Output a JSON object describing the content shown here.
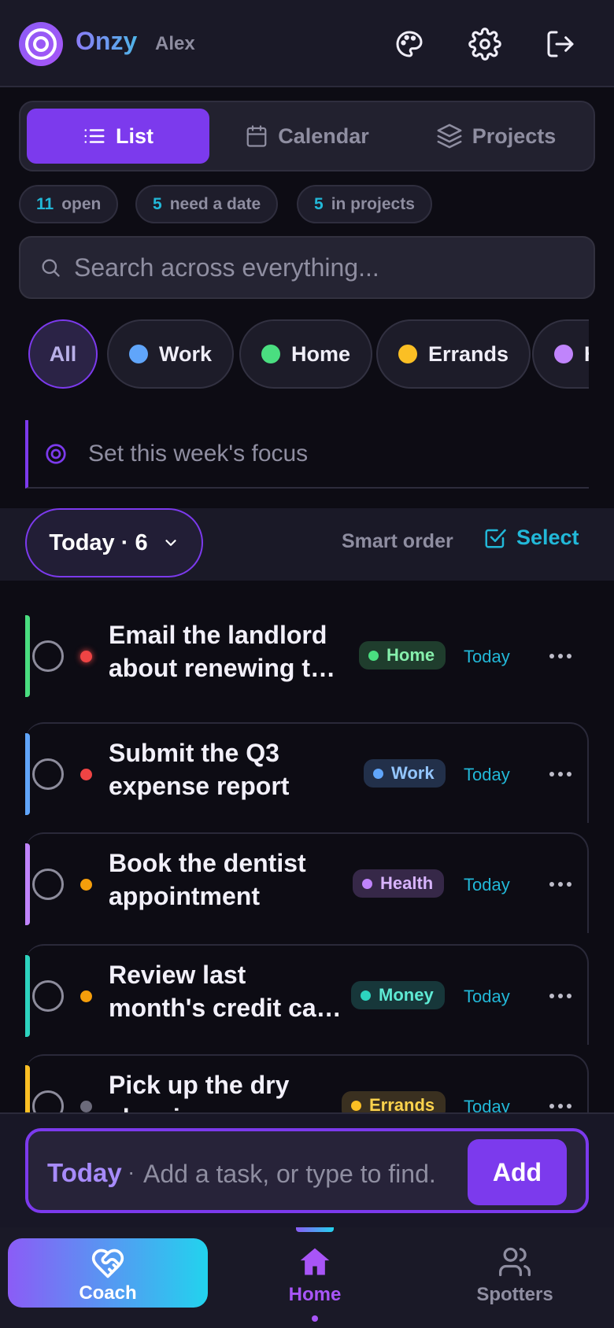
{
  "header": {
    "app_name": "Onzy",
    "username": "Alex",
    "icons": [
      "palette-icon",
      "gear-icon",
      "logout-icon"
    ]
  },
  "views": {
    "tabs": [
      {
        "label": "List",
        "icon": "list-icon",
        "active": true
      },
      {
        "label": "Calendar",
        "icon": "calendar-icon",
        "active": false
      },
      {
        "label": "Projects",
        "icon": "layers-icon",
        "active": false
      }
    ]
  },
  "stats": [
    {
      "count": "11",
      "label": "open"
    },
    {
      "count": "5",
      "label": "need a date"
    },
    {
      "count": "5",
      "label": "in projects"
    }
  ],
  "search": {
    "placeholder": "Search across everything..."
  },
  "categories": [
    {
      "label": "All",
      "active": true
    },
    {
      "label": "Work",
      "color": "#60a5fa"
    },
    {
      "label": "Home",
      "color": "#4ade80"
    },
    {
      "label": "Errands",
      "color": "#fbbf24"
    },
    {
      "label": "H",
      "color": "#c084fc"
    }
  ],
  "focus": {
    "placeholder": "Set this week's focus"
  },
  "toolbar": {
    "filter_label": "Today · 6",
    "sort_label": "Smart order",
    "select_label": "Select"
  },
  "tasks": [
    {
      "title": "Email the landlord about renewing the lease",
      "tag": "Home",
      "due": "Today",
      "priority": "high",
      "colors": {
        "bar": "#4ade80",
        "pri": "#ef4444",
        "tag_bg": "#1f3d2d",
        "tag_fg": "#86efac",
        "tag_dot": "#4ade80"
      }
    },
    {
      "title": "Submit the Q3 expense report",
      "tag": "Work",
      "due": "Today",
      "priority": "high",
      "colors": {
        "bar": "#60a5fa",
        "pri": "#ef4444",
        "tag_bg": "#22304a",
        "tag_fg": "#93c5fd",
        "tag_dot": "#60a5fa"
      }
    },
    {
      "title": "Book the dentist appointment",
      "tag": "Health",
      "due": "Today",
      "priority": "medium",
      "colors": {
        "bar": "#c084fc",
        "pri": "#f59e0b",
        "tag_bg": "#362848",
        "tag_fg": "#d8b4fe",
        "tag_dot": "#c084fc"
      }
    },
    {
      "title": "Review last month's credit card statement",
      "tag": "Money",
      "due": "Today",
      "priority": "medium",
      "colors": {
        "bar": "#2dd4bf",
        "pri": "#f59e0b",
        "tag_bg": "#17373a",
        "tag_fg": "#5eead4",
        "tag_dot": "#2dd4bf"
      }
    },
    {
      "title": "Pick up the dry cleaning",
      "tag": "Errands",
      "due": "Today",
      "priority": "low",
      "colors": {
        "bar": "#fbbf24",
        "pri": "#6b6a7a",
        "tag_bg": "#3a3020",
        "tag_fg": "#fcd34d",
        "tag_dot": "#fbbf24"
      }
    }
  ],
  "quick_add": {
    "prefix": "Today",
    "separator": "·",
    "placeholder": "Add a task, or type to find.",
    "button": "Add"
  },
  "bottom_nav": [
    {
      "label": "Coach",
      "icon": "heart-handshake-icon",
      "style": "gradient"
    },
    {
      "label": "Home",
      "icon": "home-icon",
      "active": true
    },
    {
      "label": "Spotters",
      "icon": "users-icon"
    }
  ],
  "colors": {
    "accent": "#7c3aed",
    "cyan": "#22b8d8",
    "background": "#0d0c14",
    "surface": "#1a1927"
  }
}
